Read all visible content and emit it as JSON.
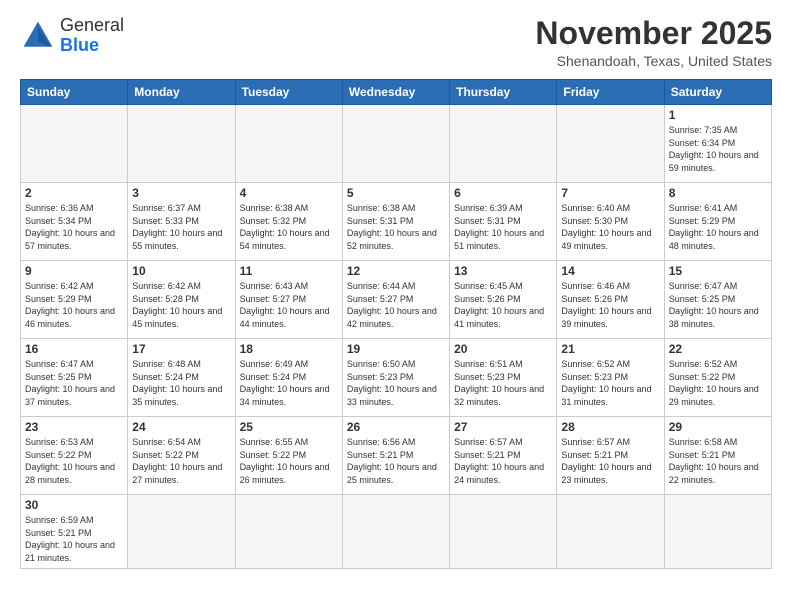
{
  "header": {
    "logo_general": "General",
    "logo_blue": "Blue",
    "month_title": "November 2025",
    "location": "Shenandoah, Texas, United States"
  },
  "weekdays": [
    "Sunday",
    "Monday",
    "Tuesday",
    "Wednesday",
    "Thursday",
    "Friday",
    "Saturday"
  ],
  "weeks": [
    [
      {
        "day": "",
        "info": ""
      },
      {
        "day": "",
        "info": ""
      },
      {
        "day": "",
        "info": ""
      },
      {
        "day": "",
        "info": ""
      },
      {
        "day": "",
        "info": ""
      },
      {
        "day": "",
        "info": ""
      },
      {
        "day": "1",
        "info": "Sunrise: 7:35 AM\nSunset: 6:34 PM\nDaylight: 10 hours and 59 minutes."
      }
    ],
    [
      {
        "day": "2",
        "info": "Sunrise: 6:36 AM\nSunset: 5:34 PM\nDaylight: 10 hours and 57 minutes."
      },
      {
        "day": "3",
        "info": "Sunrise: 6:37 AM\nSunset: 5:33 PM\nDaylight: 10 hours and 55 minutes."
      },
      {
        "day": "4",
        "info": "Sunrise: 6:38 AM\nSunset: 5:32 PM\nDaylight: 10 hours and 54 minutes."
      },
      {
        "day": "5",
        "info": "Sunrise: 6:38 AM\nSunset: 5:31 PM\nDaylight: 10 hours and 52 minutes."
      },
      {
        "day": "6",
        "info": "Sunrise: 6:39 AM\nSunset: 5:31 PM\nDaylight: 10 hours and 51 minutes."
      },
      {
        "day": "7",
        "info": "Sunrise: 6:40 AM\nSunset: 5:30 PM\nDaylight: 10 hours and 49 minutes."
      },
      {
        "day": "8",
        "info": "Sunrise: 6:41 AM\nSunset: 5:29 PM\nDaylight: 10 hours and 48 minutes."
      }
    ],
    [
      {
        "day": "9",
        "info": "Sunrise: 6:42 AM\nSunset: 5:29 PM\nDaylight: 10 hours and 46 minutes."
      },
      {
        "day": "10",
        "info": "Sunrise: 6:42 AM\nSunset: 5:28 PM\nDaylight: 10 hours and 45 minutes."
      },
      {
        "day": "11",
        "info": "Sunrise: 6:43 AM\nSunset: 5:27 PM\nDaylight: 10 hours and 44 minutes."
      },
      {
        "day": "12",
        "info": "Sunrise: 6:44 AM\nSunset: 5:27 PM\nDaylight: 10 hours and 42 minutes."
      },
      {
        "day": "13",
        "info": "Sunrise: 6:45 AM\nSunset: 5:26 PM\nDaylight: 10 hours and 41 minutes."
      },
      {
        "day": "14",
        "info": "Sunrise: 6:46 AM\nSunset: 5:26 PM\nDaylight: 10 hours and 39 minutes."
      },
      {
        "day": "15",
        "info": "Sunrise: 6:47 AM\nSunset: 5:25 PM\nDaylight: 10 hours and 38 minutes."
      }
    ],
    [
      {
        "day": "16",
        "info": "Sunrise: 6:47 AM\nSunset: 5:25 PM\nDaylight: 10 hours and 37 minutes."
      },
      {
        "day": "17",
        "info": "Sunrise: 6:48 AM\nSunset: 5:24 PM\nDaylight: 10 hours and 35 minutes."
      },
      {
        "day": "18",
        "info": "Sunrise: 6:49 AM\nSunset: 5:24 PM\nDaylight: 10 hours and 34 minutes."
      },
      {
        "day": "19",
        "info": "Sunrise: 6:50 AM\nSunset: 5:23 PM\nDaylight: 10 hours and 33 minutes."
      },
      {
        "day": "20",
        "info": "Sunrise: 6:51 AM\nSunset: 5:23 PM\nDaylight: 10 hours and 32 minutes."
      },
      {
        "day": "21",
        "info": "Sunrise: 6:52 AM\nSunset: 5:23 PM\nDaylight: 10 hours and 31 minutes."
      },
      {
        "day": "22",
        "info": "Sunrise: 6:52 AM\nSunset: 5:22 PM\nDaylight: 10 hours and 29 minutes."
      }
    ],
    [
      {
        "day": "23",
        "info": "Sunrise: 6:53 AM\nSunset: 5:22 PM\nDaylight: 10 hours and 28 minutes."
      },
      {
        "day": "24",
        "info": "Sunrise: 6:54 AM\nSunset: 5:22 PM\nDaylight: 10 hours and 27 minutes."
      },
      {
        "day": "25",
        "info": "Sunrise: 6:55 AM\nSunset: 5:22 PM\nDaylight: 10 hours and 26 minutes."
      },
      {
        "day": "26",
        "info": "Sunrise: 6:56 AM\nSunset: 5:21 PM\nDaylight: 10 hours and 25 minutes."
      },
      {
        "day": "27",
        "info": "Sunrise: 6:57 AM\nSunset: 5:21 PM\nDaylight: 10 hours and 24 minutes."
      },
      {
        "day": "28",
        "info": "Sunrise: 6:57 AM\nSunset: 5:21 PM\nDaylight: 10 hours and 23 minutes."
      },
      {
        "day": "29",
        "info": "Sunrise: 6:58 AM\nSunset: 5:21 PM\nDaylight: 10 hours and 22 minutes."
      }
    ],
    [
      {
        "day": "30",
        "info": "Sunrise: 6:59 AM\nSunset: 5:21 PM\nDaylight: 10 hours and 21 minutes."
      },
      {
        "day": "",
        "info": ""
      },
      {
        "day": "",
        "info": ""
      },
      {
        "day": "",
        "info": ""
      },
      {
        "day": "",
        "info": ""
      },
      {
        "day": "",
        "info": ""
      },
      {
        "day": "",
        "info": ""
      }
    ]
  ]
}
